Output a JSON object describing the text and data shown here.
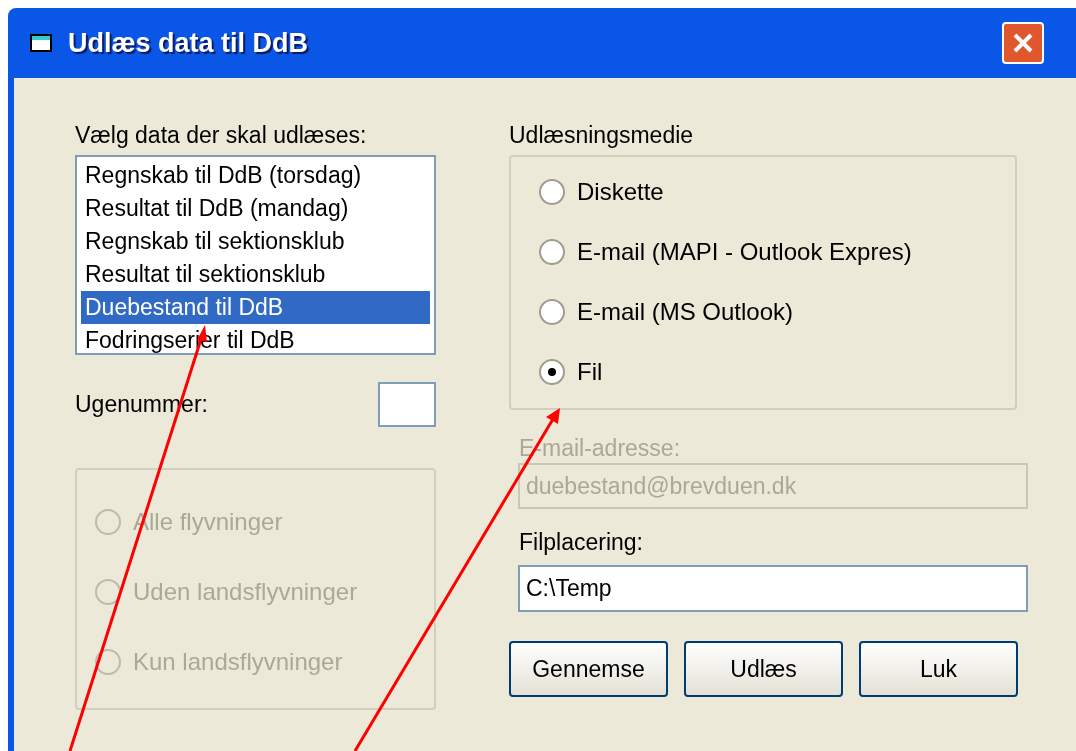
{
  "window": {
    "title": "Udlæs data til DdB"
  },
  "data_list": {
    "label": "Vælg data der skal udlæses:",
    "items": [
      {
        "label": "Regnskab til DdB (torsdag)",
        "selected": false
      },
      {
        "label": "Resultat til DdB (mandag)",
        "selected": false
      },
      {
        "label": "Regnskab til sektionsklub",
        "selected": false
      },
      {
        "label": "Resultat til sektionsklub",
        "selected": false
      },
      {
        "label": "Duebestand til DdB",
        "selected": true
      },
      {
        "label": "Fodringserier til DdB",
        "selected": false
      }
    ]
  },
  "week": {
    "label": "Ugenummer:"
  },
  "flights": {
    "disabled": true,
    "options": [
      {
        "label": "Alle flyvninger",
        "selected": false
      },
      {
        "label": "Uden landsflyvninger",
        "selected": false
      },
      {
        "label": "Kun landsflyvninger",
        "selected": false
      }
    ]
  },
  "medium": {
    "label": "Udlæsningsmedie",
    "options": [
      {
        "label": "Diskette",
        "selected": false
      },
      {
        "label": "E-mail (MAPI - Outlook Expres)",
        "selected": false
      },
      {
        "label": "E-mail (MS Outlook)",
        "selected": false
      },
      {
        "label": "Fil",
        "selected": true
      }
    ]
  },
  "email": {
    "label": "E-mail-adresse:",
    "value": "duebestand@brevduen.dk",
    "disabled": true
  },
  "file": {
    "label": "Filplacering:",
    "value": "C:\\Temp",
    "disabled": false
  },
  "buttons": [
    "Gennemse",
    "Udlæs",
    "Luk"
  ]
}
